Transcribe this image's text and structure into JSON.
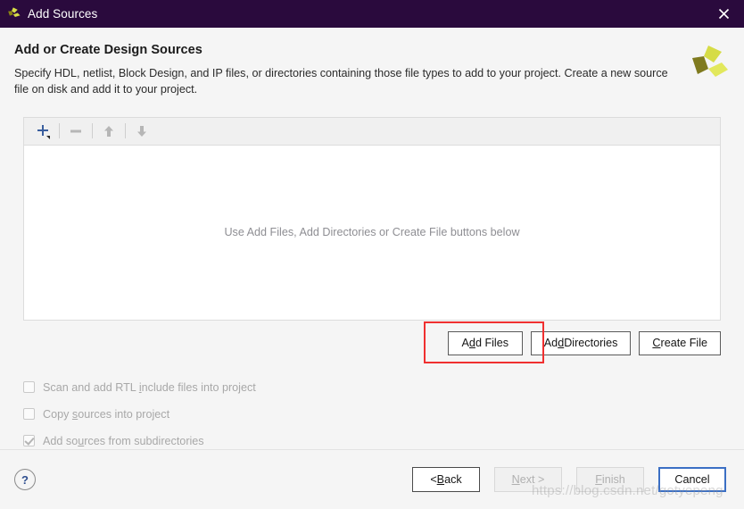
{
  "titlebar": {
    "title": "Add Sources",
    "app_icon": "xilinx-logo-icon",
    "close_icon": "close-icon"
  },
  "header": {
    "title": "Add or Create Design Sources",
    "description": "Specify HDL, netlist, Block Design, and IP files, or directories containing those file types to add to your project. Create a new source file on disk and add it to your project.",
    "logo": "xilinx-logo"
  },
  "panel": {
    "toolbar": {
      "add_label": "+",
      "remove_label": "−",
      "move_up_label": "↑",
      "move_down_label": "↓"
    },
    "empty_message": "Use Add Files, Add Directories or Create File buttons below"
  },
  "actions": {
    "add_files": {
      "pre": "A",
      "mn": "d",
      "post": "d Files"
    },
    "add_directories": {
      "pre": "Ad",
      "mn": "d",
      "post": " Directories"
    },
    "create_file": {
      "pre": "",
      "mn": "C",
      "post": "reate File"
    }
  },
  "options": [
    {
      "pre": "Scan and add RTL ",
      "mn": "i",
      "post": "nclude files into project",
      "checked": false,
      "enabled": false
    },
    {
      "pre": "Copy ",
      "mn": "s",
      "post": "ources into project",
      "checked": false,
      "enabled": false
    },
    {
      "pre": "Add so",
      "mn": "u",
      "post": "rces from subdirectories",
      "checked": true,
      "enabled": false
    }
  ],
  "footer": {
    "help_label": "?",
    "back": {
      "pre": "< ",
      "mn": "B",
      "post": "ack"
    },
    "next": {
      "pre": "",
      "mn": "N",
      "post": "ext >"
    },
    "finish": {
      "pre": "",
      "mn": "F",
      "post": "inish"
    },
    "cancel": {
      "pre": "Cancel",
      "mn": "",
      "post": ""
    }
  },
  "watermark": "https://blog.csdn.net/gotyepeng",
  "colors": {
    "titlebar_bg": "#2a0a3d",
    "dialog_bg": "#f5f5f5",
    "accent_blue": "#3b6fc4",
    "annotation_red": "#f03030",
    "logo_olive": "#7f7a1e",
    "logo_yellow": "#d6dc46"
  }
}
